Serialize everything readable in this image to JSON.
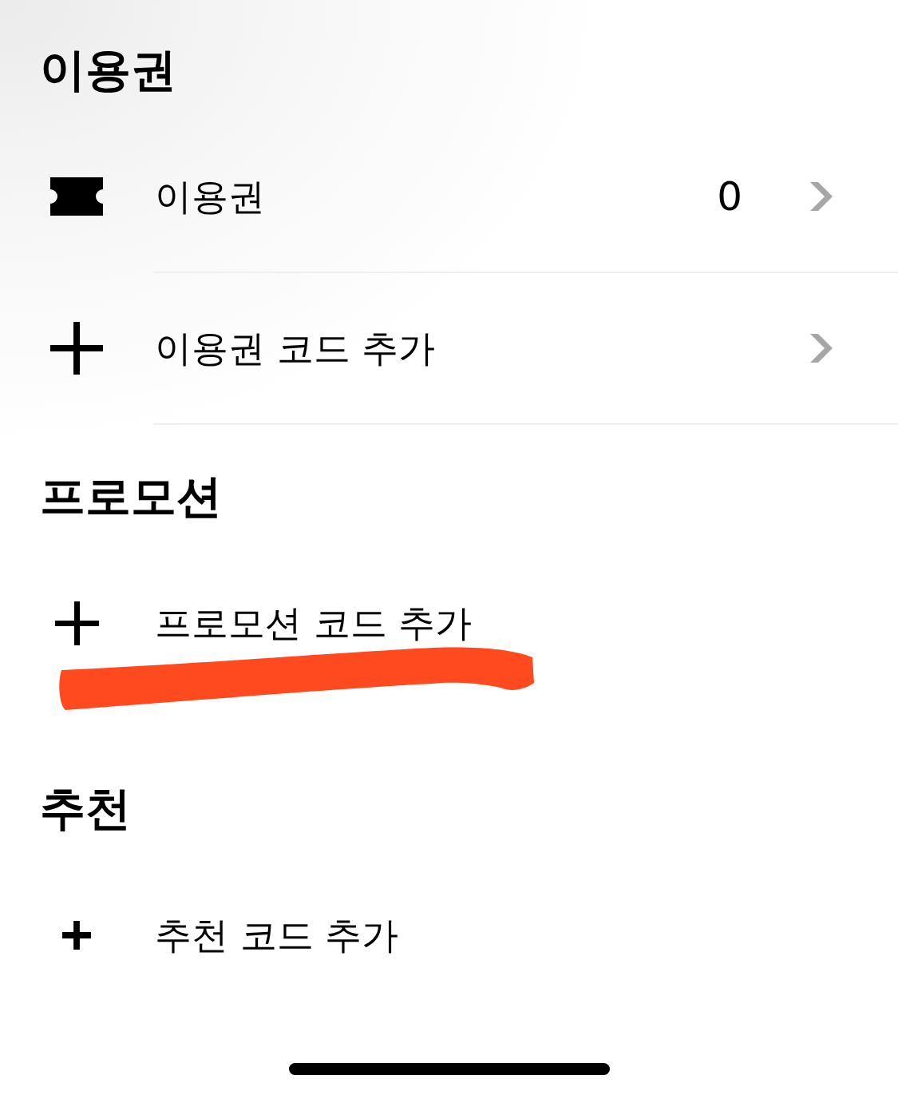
{
  "sections": [
    {
      "title": "이용권",
      "items": [
        {
          "kind": "ticket",
          "label": "이용권",
          "count": "0",
          "chevron": true,
          "divider": true,
          "marked": false
        },
        {
          "kind": "add",
          "label": "이용권 코드 추가",
          "chevron": true,
          "divider": true,
          "marked": false
        }
      ]
    },
    {
      "title": "프로모션",
      "items": [
        {
          "kind": "add",
          "label": "프로모션 코드 추가",
          "chevron": false,
          "divider": false,
          "marked": true
        }
      ]
    },
    {
      "title": "추천",
      "items": [
        {
          "kind": "add",
          "label": "추천 코드 추가",
          "chevron": false,
          "divider": false,
          "marked": false
        }
      ]
    }
  ]
}
